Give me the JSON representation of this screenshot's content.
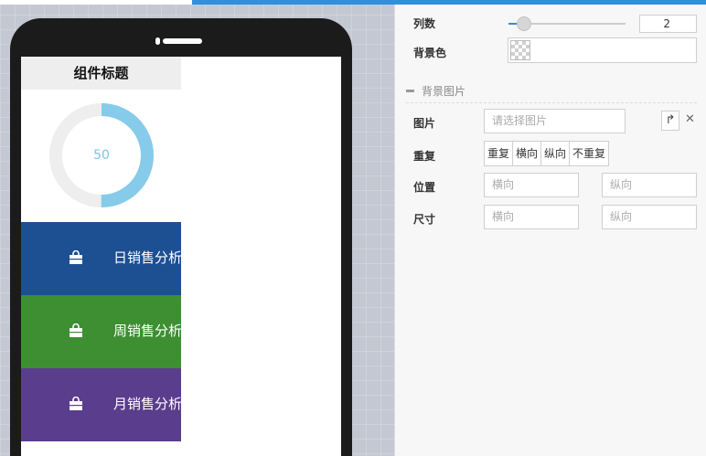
{
  "canvas": {
    "widget": {
      "title": "组件标题",
      "gauge": {
        "value_label": "50",
        "percent": 50,
        "color": "#86cbe9",
        "track_color": "#eeeeee"
      },
      "menu": [
        {
          "label": "日销售分析",
          "icon": "shopping-bag-icon",
          "color": "#1d4f93"
        },
        {
          "label": "周销售分析",
          "icon": "shopping-bag-icon",
          "color": "#3d8f32"
        },
        {
          "label": "月销售分析",
          "icon": "shopping-bag-icon",
          "color": "#5a3d8d"
        }
      ]
    }
  },
  "panel": {
    "columns": {
      "label": "列数",
      "value": "2",
      "slider_fraction": 0.13
    },
    "background_color": {
      "label": "背景色"
    },
    "background_image": {
      "section_title": "背景图片",
      "image": {
        "label": "图片",
        "placeholder": "请选择图片"
      },
      "repeat": {
        "label": "重复",
        "options": [
          "重复",
          "横向",
          "纵向",
          "不重复"
        ]
      },
      "position": {
        "label": "位置",
        "x_placeholder": "横向",
        "y_placeholder": "纵向"
      },
      "size": {
        "label": "尺寸",
        "x_placeholder": "横向",
        "y_placeholder": "纵向"
      }
    }
  },
  "colors": {
    "accent": "#2f8fe0"
  }
}
